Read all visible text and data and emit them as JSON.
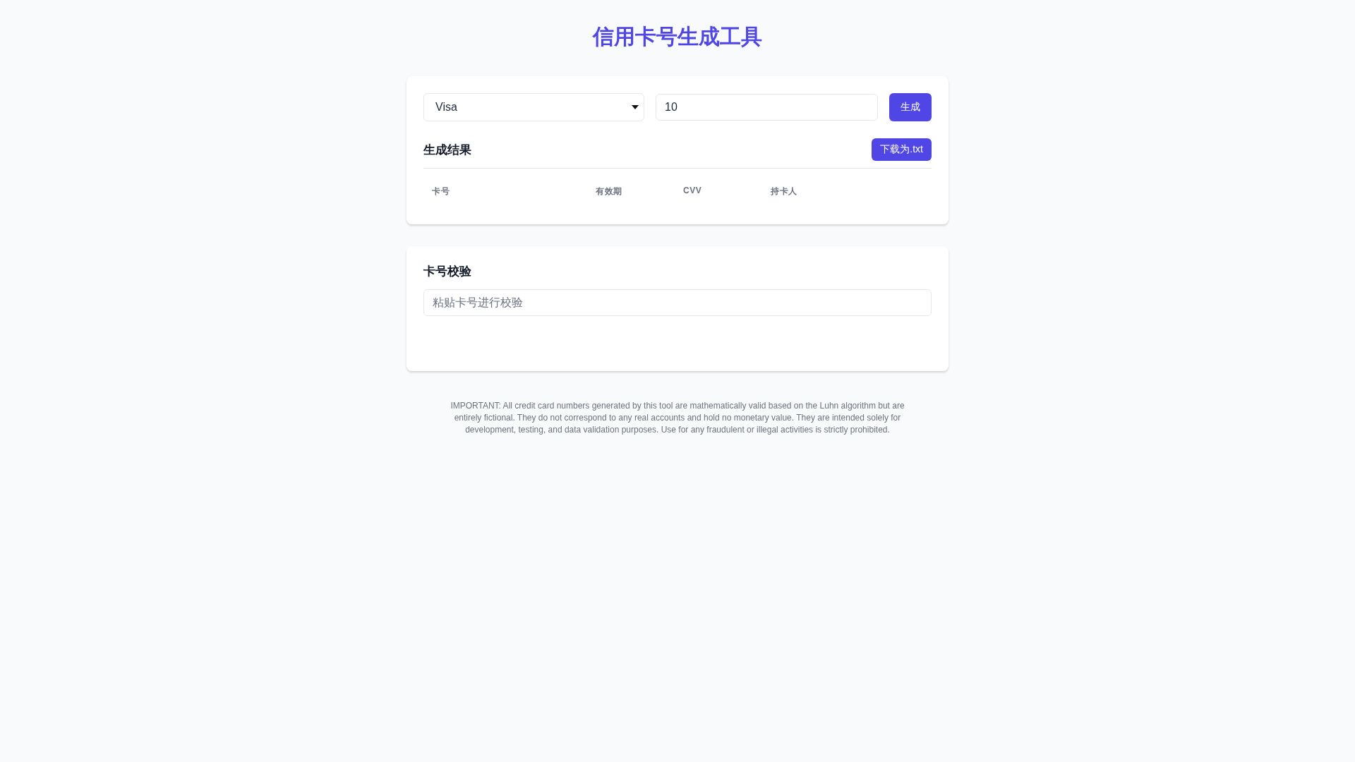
{
  "title": "信用卡号生成工具",
  "generator": {
    "card_type": "Visa",
    "count": "10",
    "generate_button": "生成"
  },
  "results": {
    "heading": "生成结果",
    "download_button": "下载为.txt",
    "columns": [
      "卡号",
      "有效期",
      "CVV",
      "持卡人"
    ]
  },
  "validator": {
    "heading": "卡号校验",
    "placeholder": "粘贴卡号进行校验"
  },
  "disclaimer": "IMPORTANT: All credit card numbers generated by this tool are mathematically valid based on the Luhn algorithm but are entirely fictional. They do not correspond to any real accounts and hold no monetary value. They are intended solely for development, testing, and data validation purposes. Use for any fraudulent or illegal activities is strictly prohibited."
}
